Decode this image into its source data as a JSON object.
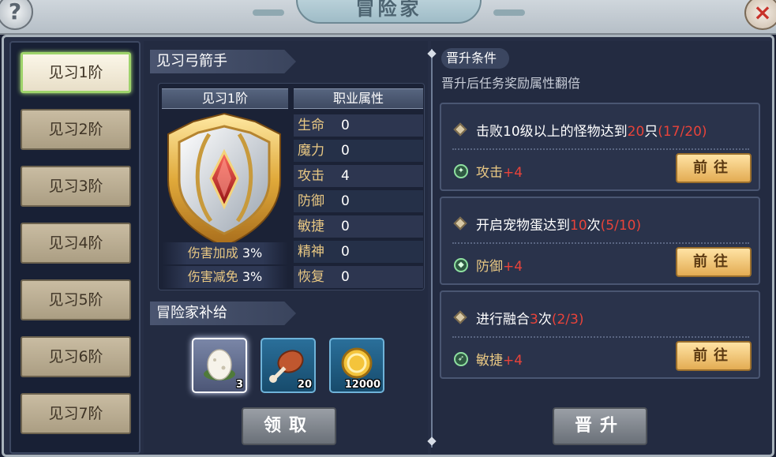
{
  "window": {
    "title": "冒险家"
  },
  "top_bar": {
    "help_label": "?",
    "close_label": "×"
  },
  "nav": {
    "items": [
      {
        "label": "见习1阶",
        "active": true
      },
      {
        "label": "见习2阶"
      },
      {
        "label": "见习3阶"
      },
      {
        "label": "见习4阶"
      },
      {
        "label": "见习5阶"
      },
      {
        "label": "见习6阶"
      },
      {
        "label": "见习7阶"
      }
    ]
  },
  "class_panel": {
    "title": "见习弓箭手",
    "rank_label": "见习1阶",
    "attr_header": "职业属性",
    "stats": [
      {
        "name": "生命",
        "value": "0"
      },
      {
        "name": "魔力",
        "value": "0"
      },
      {
        "name": "攻击",
        "value": "4"
      },
      {
        "name": "防御",
        "value": "0"
      },
      {
        "name": "敏捷",
        "value": "0"
      },
      {
        "name": "精神",
        "value": "0"
      },
      {
        "name": "恢复",
        "value": "0"
      }
    ],
    "bonuses": [
      {
        "name": "伤害加成",
        "value": "3%"
      },
      {
        "name": "伤害减免",
        "value": "3%"
      }
    ]
  },
  "supply": {
    "title": "冒险家补给",
    "items": [
      {
        "icon": "pet-egg-icon",
        "count": "3"
      },
      {
        "icon": "meat-leg-icon",
        "count": "20"
      },
      {
        "icon": "gold-coin-icon",
        "count": "12000"
      }
    ],
    "claim_label": "领取"
  },
  "promotion": {
    "title": "晋升条件",
    "description": "晋升后任务奖励属性翻倍",
    "conditions": [
      {
        "pre": "击败10级以上的怪物达到",
        "target": "20",
        "post": "只",
        "progress": "(17/20)",
        "reward_name": "攻击",
        "reward_value": "+4",
        "icon": "attack-icon",
        "goto_label": "前往"
      },
      {
        "pre": "开启宠物蛋达到",
        "target": "10",
        "post": "次",
        "progress": "(5/10)",
        "reward_name": "防御",
        "reward_value": "+4",
        "icon": "defense-icon",
        "goto_label": "前往"
      },
      {
        "pre": "进行融合",
        "target": "3",
        "post": "次",
        "progress": "(2/3)",
        "reward_name": "敏捷",
        "reward_value": "+4",
        "icon": "agility-icon",
        "goto_label": "前往"
      }
    ],
    "promote_label": "晋升"
  },
  "colors": {
    "accent_red": "#e8433a",
    "gold_text": "#e9c883",
    "goto_button": "#e3ac53",
    "active_nav_border": "#9ed36b"
  }
}
